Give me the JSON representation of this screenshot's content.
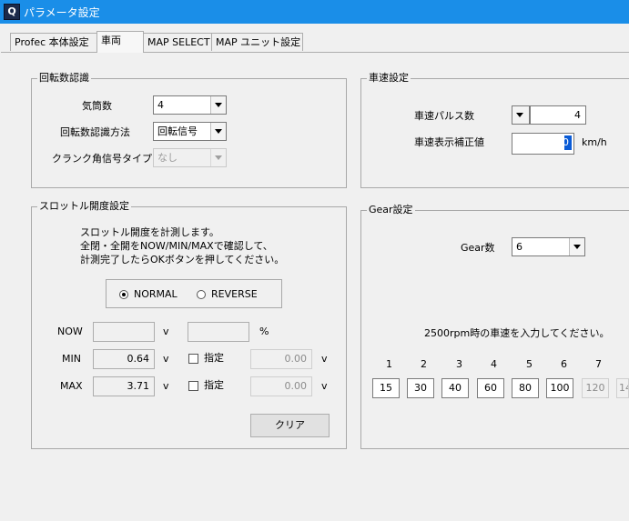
{
  "window": {
    "title": "パラメータ設定",
    "icon_label": "Q"
  },
  "tabs": [
    {
      "label": "Profec 本体設定"
    },
    {
      "label": "車両"
    },
    {
      "label": "MAP SELECT"
    },
    {
      "label": "MAP ユニット設定"
    }
  ],
  "rotation": {
    "title": "回転数認識",
    "cylinders_label": "気筒数",
    "cylinders_value": "4",
    "method_label": "回転数認識方法",
    "method_value": "回転信号",
    "crank_label": "クランク角信号タイプ",
    "crank_value": "なし"
  },
  "speed": {
    "title": "車速設定",
    "pulse_label": "車速パルス数",
    "pulse_value": "4",
    "correction_label": "車速表示補正値",
    "correction_value": "0",
    "unit": "km/h"
  },
  "throttle": {
    "title": "スロットル開度設定",
    "desc1": "スロットル開度を計測します。",
    "desc2": "全閉・全開をNOW/MIN/MAXで確認して、",
    "desc3": "計測完了したらOKボタンを押してください。",
    "normal_label": "NORMAL",
    "reverse_label": "REVERSE",
    "now_label": "NOW",
    "now_value": "",
    "now_percent": "",
    "min_label": "MIN",
    "min_value": "0.64",
    "max_label": "MAX",
    "max_value": "3.71",
    "v_unit": "v",
    "pct_unit": "%",
    "specify_label": "指定",
    "min_specify_value": "0.00",
    "max_specify_value": "0.00",
    "clear_label": "クリア"
  },
  "gear": {
    "title": "Gear設定",
    "count_label": "Gear数",
    "count_value": "6",
    "instruction": "2500rpm時の車速を入力してください。",
    "numbers": [
      "1",
      "2",
      "3",
      "4",
      "5",
      "6",
      "7"
    ],
    "values": [
      "15",
      "30",
      "40",
      "60",
      "80",
      "100",
      "120",
      "14"
    ]
  },
  "colors": {
    "titlebar": "#1a8ee8",
    "selection": "#0a5bd6"
  }
}
